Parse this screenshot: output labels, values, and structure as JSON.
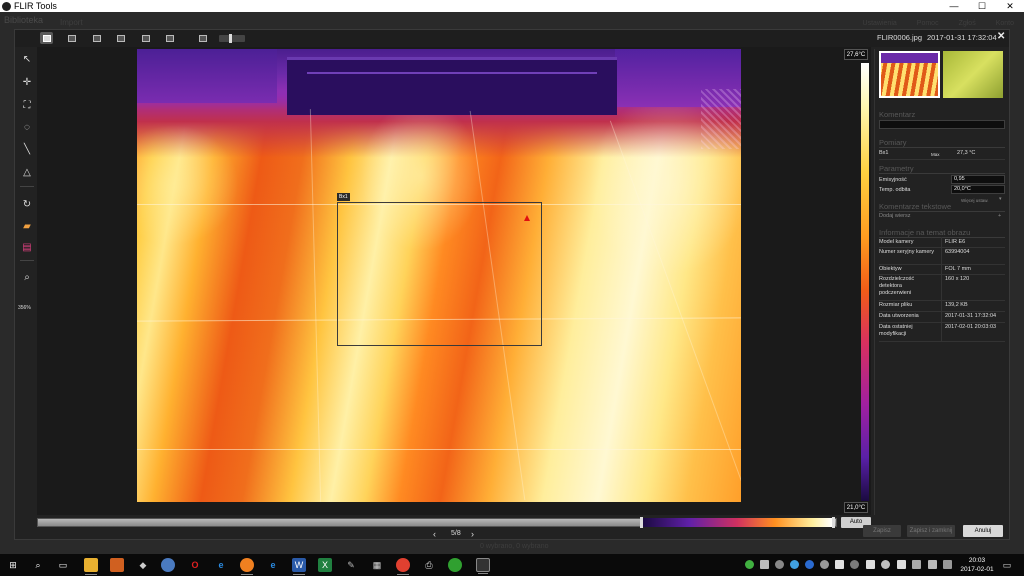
{
  "window": {
    "title": "FLIR Tools",
    "caption_minimize": "—",
    "caption_maximize": "☐",
    "caption_close": "✕"
  },
  "background_app": {
    "nav_title": "Biblioteka",
    "nav_sub": "Import",
    "right_items": [
      "Ustawienia",
      "Pomoc",
      "Zgłoś",
      "Konto"
    ],
    "bottom_text": "0 wybrano, 0 wybrano"
  },
  "toolbar": {
    "file_name": "FLIR0006.jpg",
    "file_datetime": "2017-01-31 17:32:04",
    "close_label": "✕"
  },
  "tools": {
    "zoom_level": "356%"
  },
  "image": {
    "measurement_label": "Bx1",
    "scale_max": "27,6°C",
    "scale_min": "21,0°C",
    "palette": "iron"
  },
  "panel": {
    "comment_header": "Komentarz",
    "comment_value": "",
    "measurements_header": "Pomiary",
    "measurement_name": "Bx1",
    "measurement_type": "Max",
    "measurement_value": "27,3 °C",
    "params_header": "Parametry",
    "emissivity_label": "Emisyjność",
    "emissivity_value": "0,95",
    "refl_temp_label": "Temp. odbita",
    "refl_temp_value": "20,0°C",
    "more_link": "Więcej ustaw.",
    "text_comments_header": "Komentarze tekstowe",
    "add_row_label": "Dodaj wiersz",
    "add_plus": "+",
    "info_header": "Informacje na temat obrazu",
    "info_rows": [
      {
        "label": "Model kamery",
        "value": "FLIR E6"
      },
      {
        "label": "Numer seryjny kamery",
        "value": "63994004"
      },
      {
        "label": "Obiektyw",
        "value": "FOL 7 mm"
      },
      {
        "label": "Rozdzielczość detektora podczerwieni",
        "value": "160 x 120"
      },
      {
        "label": "Rozmiar pliku",
        "value": "139,2 KB"
      },
      {
        "label": "Data utworzenia",
        "value": "2017-01-31 17:32:04"
      },
      {
        "label": "Data ostatniej modyfikacji",
        "value": "2017-02-01 20:03:03"
      }
    ]
  },
  "bottom": {
    "auto_label": "Auto",
    "prev": "‹",
    "page": "5/8",
    "next": "›"
  },
  "buttons": {
    "save": "Zapisz",
    "save_close": "Zapisz i zamknij",
    "cancel": "Anuluj"
  },
  "taskbar": {
    "clock_time": "20:03",
    "clock_date": "2017-02-01"
  },
  "colors": {
    "accent_red_marker": "#e01010",
    "panel_bg": "#222222",
    "input_bg": "#0e0e0e"
  }
}
